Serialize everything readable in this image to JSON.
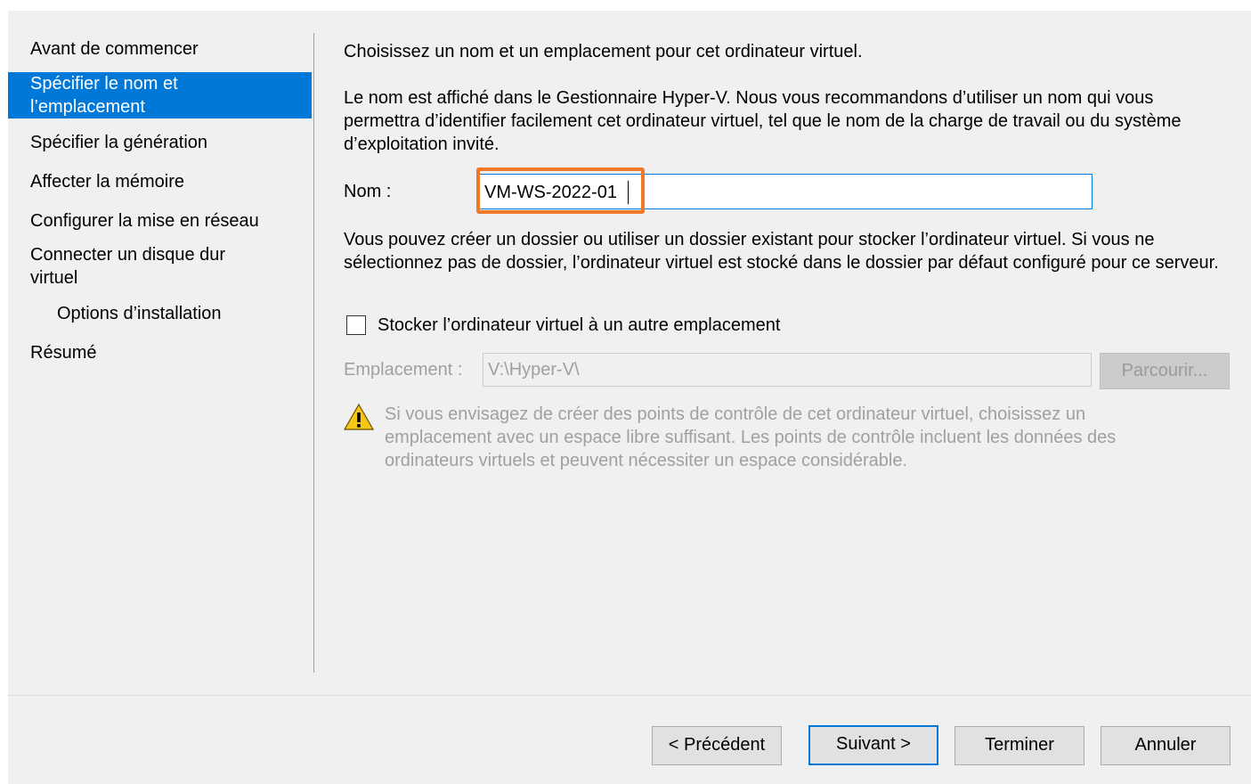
{
  "sidebar": {
    "items": [
      {
        "label": "Avant de commencer"
      },
      {
        "label": "Spécifier le nom et l’emplacement"
      },
      {
        "label": "Spécifier la génération"
      },
      {
        "label": "Affecter la mémoire"
      },
      {
        "label": "Configurer la mise en réseau"
      },
      {
        "label": "Connecter un disque dur virtuel"
      },
      {
        "label": "Options d’installation"
      },
      {
        "label": "Résumé"
      }
    ]
  },
  "main": {
    "heading": "Choisissez un nom et un emplacement pour cet ordinateur virtuel.",
    "name_description": "Le nom est affiché dans le Gestionnaire Hyper-V. Nous vous recommandons d’utiliser un nom qui vous permettra d’identifier facilement cet ordinateur virtuel, tel que le nom de la charge de travail ou du système d’exploitation invité.",
    "name_label": "Nom :",
    "name_value": "VM-WS-2022-01",
    "folder_description": "Vous pouvez créer un dossier ou utiliser un dossier existant pour stocker l’ordinateur virtuel. Si vous ne sélectionnez pas de dossier, l’ordinateur virtuel est stocké dans le dossier par défaut configuré pour ce serveur.",
    "store_checkbox_label": "Stocker l’ordinateur virtuel à un autre emplacement",
    "location_label": "Emplacement :",
    "location_value": "V:\\Hyper-V\\",
    "browse_label": "Parcourir...",
    "warning_text": "Si vous envisagez de créer des points de contrôle de cet ordinateur virtuel, choisissez un emplacement avec un espace libre suffisant. Les points de contrôle incluent les données des ordinateurs virtuels et peuvent nécessiter un espace considérable."
  },
  "footer": {
    "previous_label": "< Précédent",
    "next_label": "Suivant >",
    "finish_label": "Terminer",
    "cancel_label": "Annuler"
  },
  "colors": {
    "selection": "#0078d7",
    "highlight": "#f07a2a",
    "dialog_background": "#f0f0f0"
  }
}
